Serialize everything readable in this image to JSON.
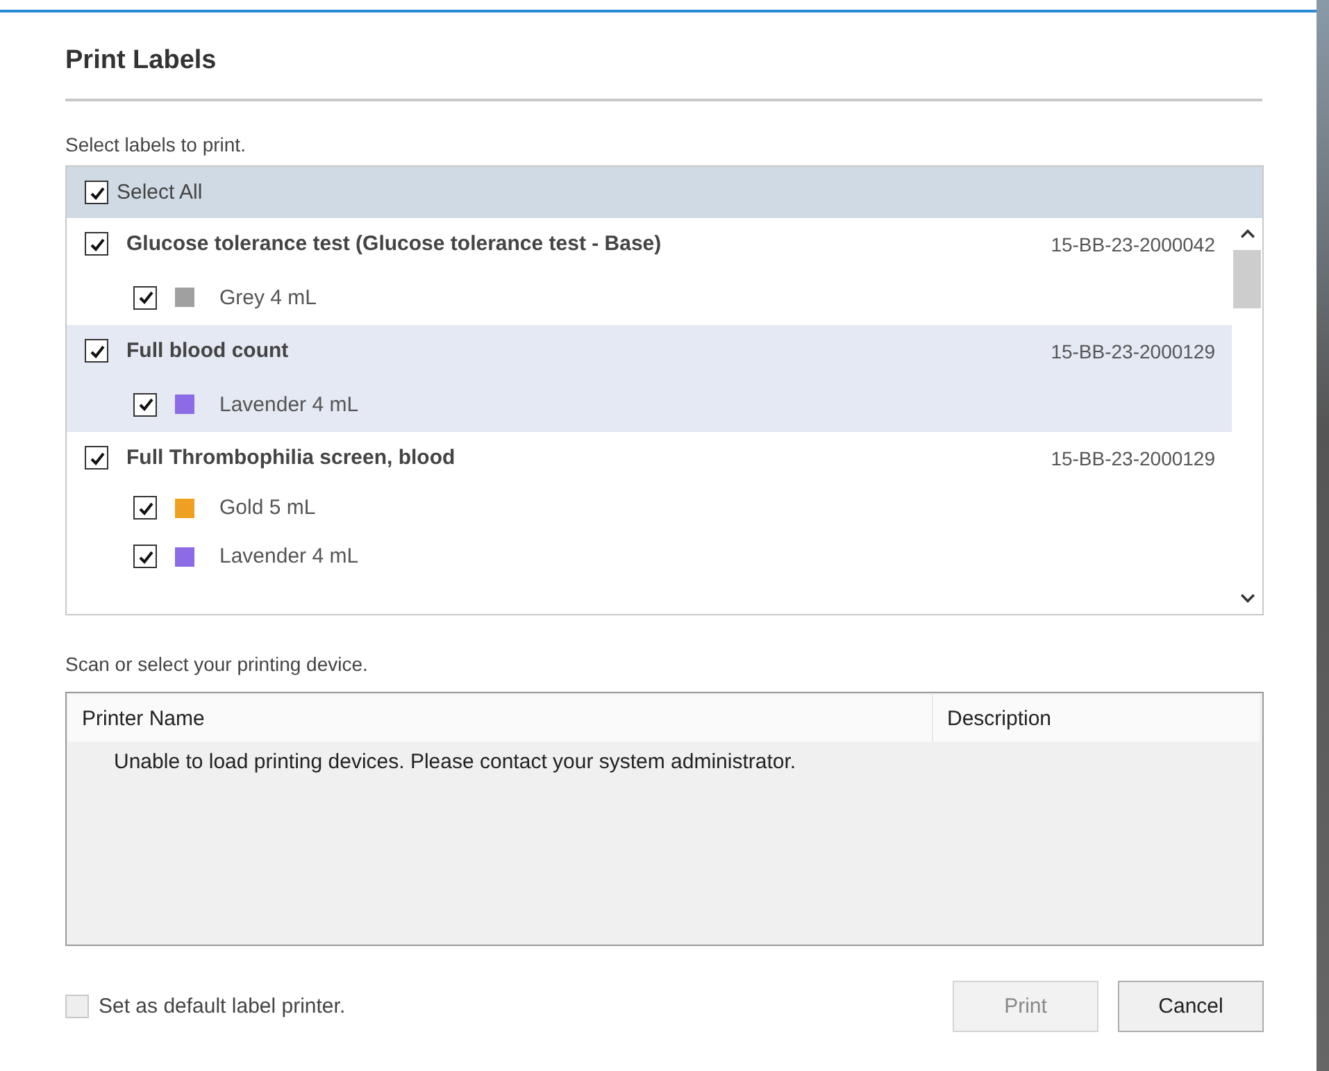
{
  "window": {
    "title": "Print Labels"
  },
  "labels_prompt": "Select labels to print.",
  "select_all": {
    "label": "Select All",
    "checked": true
  },
  "tests": [
    {
      "name": "Glucose tolerance test (Glucose tolerance test - Base)",
      "accession": "15-BB-23-2000042",
      "checked": true,
      "selected": false,
      "tubes": [
        {
          "label": "Grey 4 mL",
          "checked": true,
          "color": "#a0a0a0"
        }
      ]
    },
    {
      "name": "Full blood count",
      "accession": "15-BB-23-2000129",
      "checked": true,
      "selected": true,
      "tubes": [
        {
          "label": "Lavender 4 mL",
          "checked": true,
          "color": "#8e6be6"
        }
      ]
    },
    {
      "name": "Full Thrombophilia screen, blood",
      "accession": "15-BB-23-2000129",
      "checked": true,
      "selected": false,
      "tubes": [
        {
          "label": "Gold 5 mL",
          "checked": true,
          "color": "#f0a020"
        },
        {
          "label": "Lavender 4 mL",
          "checked": true,
          "color": "#8e6be6"
        }
      ]
    }
  ],
  "device_prompt": "Scan or select your printing device.",
  "printer_table": {
    "columns": [
      "Printer Name",
      "Description"
    ],
    "message": "Unable to load printing devices. Please contact your system administrator."
  },
  "default_printer": {
    "label": "Set as default label printer.",
    "checked": false,
    "disabled": true
  },
  "buttons": [
    {
      "label": "Print",
      "disabled": true
    },
    {
      "label": "Cancel",
      "disabled": false
    }
  ]
}
